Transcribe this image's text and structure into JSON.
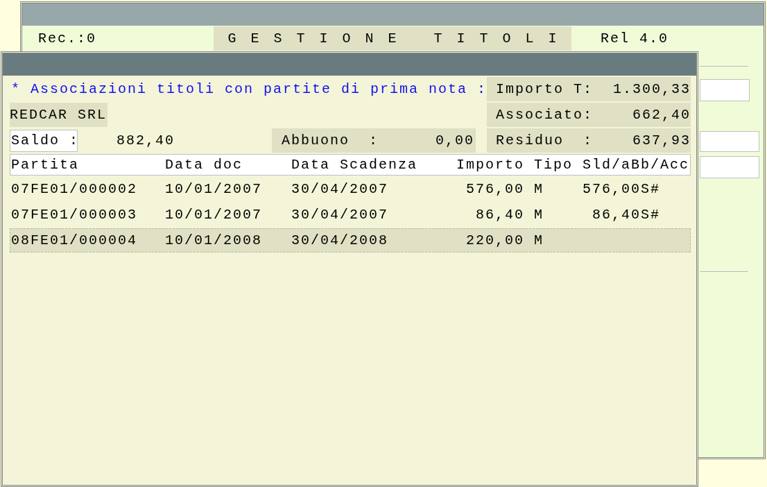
{
  "back_window": {
    "record": "Rec.:0",
    "title": "GESTIONE TITOLI",
    "release": "Rel 4.0"
  },
  "dialog": {
    "heading": "* Associazioni titoli con partite di prima nota :",
    "customer": "REDCAR SRL",
    "saldo_label": "Saldo :",
    "saldo": "882,40",
    "abbuono_label": "Abbuono  :",
    "abbuono": "0,00",
    "totals": [
      {
        "label": "Importo T:",
        "value": "1.300,33"
      },
      {
        "label": "Associato:",
        "value": "662,40"
      },
      {
        "label": "Residuo  :",
        "value": "637,93"
      }
    ]
  },
  "table": {
    "columns": [
      "Partita",
      "Data doc",
      "Data Scadenza",
      "Importo",
      "Tipo",
      "Sld/aBb/Acc"
    ],
    "rows": [
      {
        "partita": "07FE01/000002",
        "data_doc": "10/01/2007",
        "data_scadenza": "30/04/2007",
        "importo": "576,00",
        "tipo": "M",
        "sld": "576,00S#",
        "selected": false
      },
      {
        "partita": "07FE01/000003",
        "data_doc": "10/01/2007",
        "data_scadenza": "30/04/2007",
        "importo": "86,40",
        "tipo": "M",
        "sld": "86,40S#",
        "selected": false
      },
      {
        "partita": "08FE01/000004",
        "data_doc": "10/01/2008",
        "data_scadenza": "30/04/2008",
        "importo": "220,00",
        "tipo": "M",
        "selected": true
      }
    ]
  }
}
